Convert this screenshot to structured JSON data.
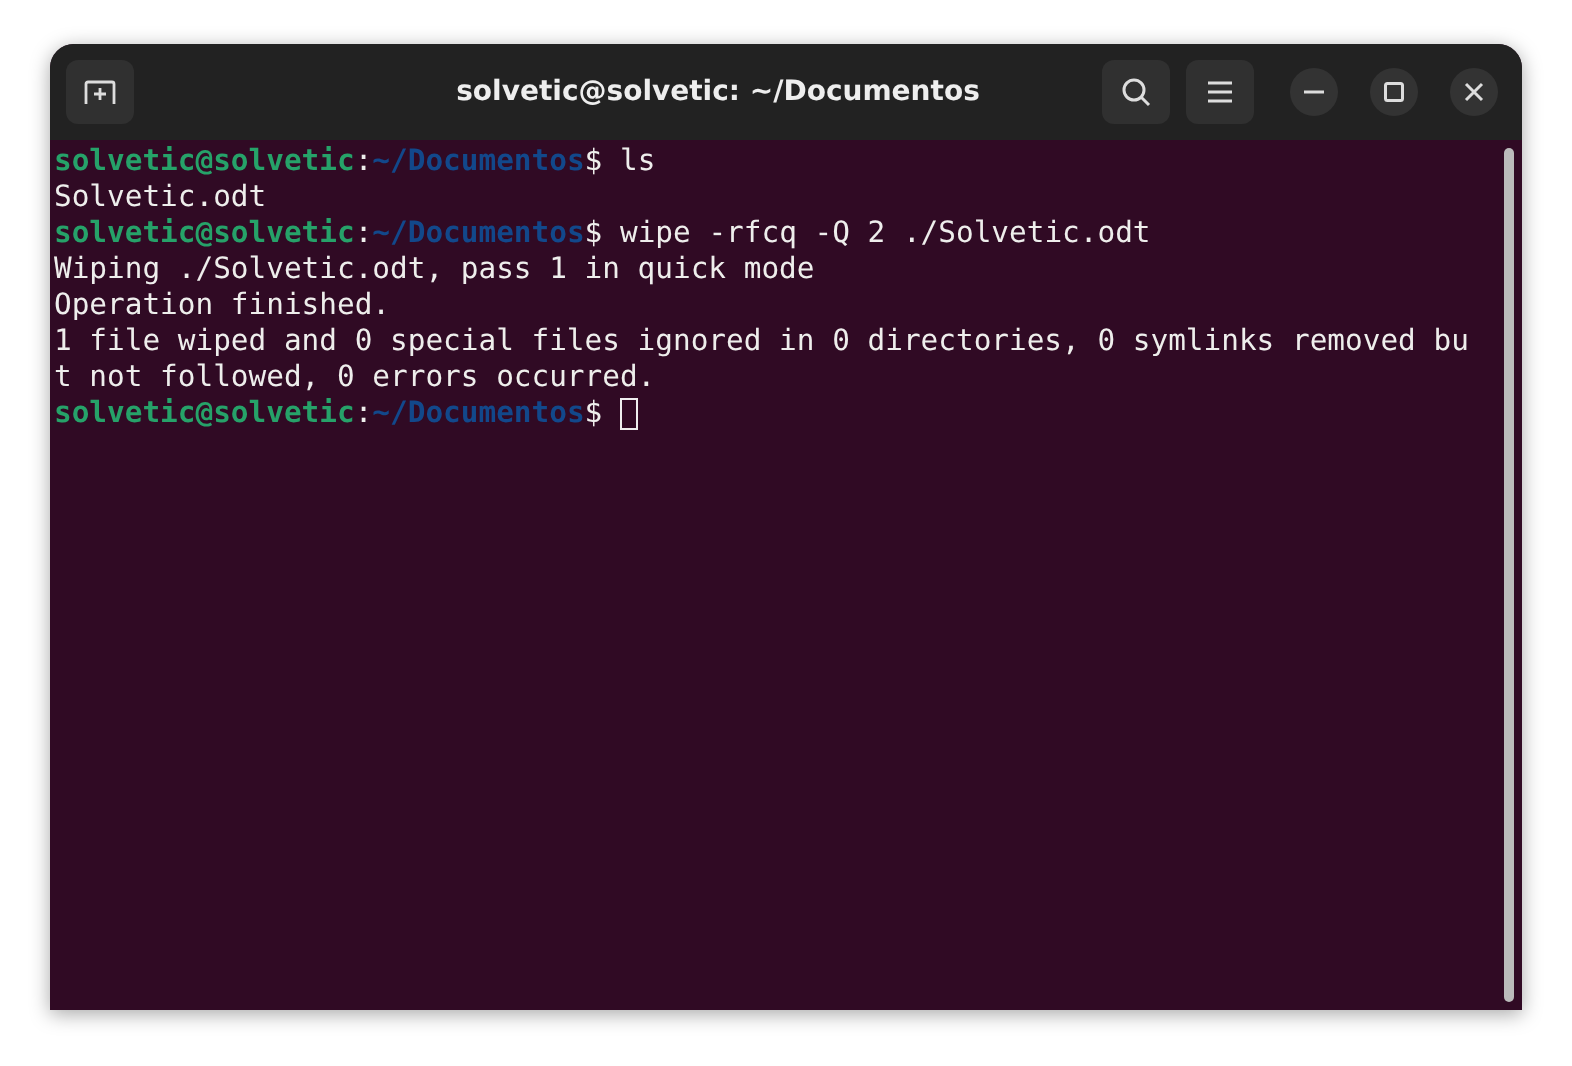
{
  "window": {
    "title": "solvetic@solvetic: ~/Documentos"
  },
  "lines": [
    {
      "kind": "prompt",
      "user": "solvetic@solvetic",
      "colon": ":",
      "path": "~/Documentos",
      "command": "$ ls",
      "cursor": false
    },
    {
      "kind": "output",
      "text": "Solvetic.odt"
    },
    {
      "kind": "prompt",
      "user": "solvetic@solvetic",
      "colon": ":",
      "path": "~/Documentos",
      "command": "$ wipe -rfcq -Q 2 ./Solvetic.odt",
      "cursor": false
    },
    {
      "kind": "output",
      "text": "Wiping ./Solvetic.odt, pass 1 in quick mode"
    },
    {
      "kind": "output",
      "text": "Operation finished."
    },
    {
      "kind": "output",
      "text": "1 file wiped and 0 special files ignored in 0 directories, 0 symlinks removed bu"
    },
    {
      "kind": "output",
      "text": "t not followed, 0 errors occurred."
    },
    {
      "kind": "prompt",
      "user": "solvetic@solvetic",
      "colon": ":",
      "path": "~/Documentos",
      "command": "$ ",
      "cursor": true
    }
  ]
}
